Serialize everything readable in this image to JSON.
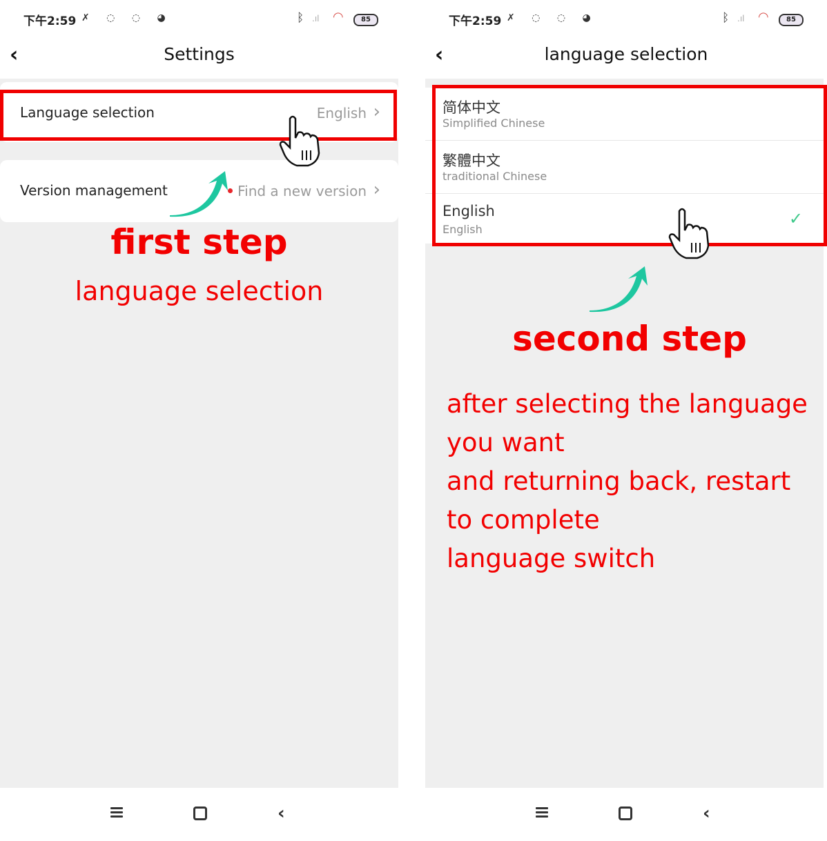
{
  "status_bar": {
    "time": "下午2:59",
    "battery": "85"
  },
  "screen1": {
    "title": "Settings",
    "rows": [
      {
        "label": "Language selection",
        "value": "English"
      },
      {
        "label": "Version management",
        "value": "Find a new version"
      }
    ],
    "annotation_step": "first step",
    "annotation_note": "language selection"
  },
  "screen2": {
    "title": "language selection",
    "languages": [
      {
        "name": "简体中文",
        "subtitle": "Simplified Chinese",
        "selected": false
      },
      {
        "name": "繁體中文",
        "subtitle": "traditional Chinese",
        "selected": false
      },
      {
        "name": "English",
        "subtitle": "English",
        "selected": true
      }
    ],
    "annotation_step": "second step",
    "annotation_lines": [
      "after selecting the language",
      "you want",
      "and returning back, restart",
      "to complete",
      "language switch"
    ]
  },
  "colors": {
    "annotation_red": "#f20000",
    "arrow_green": "#1ec7a0",
    "check_green": "#3fc98a"
  },
  "icons": [
    "back-icon",
    "chevron-right-icon",
    "hand-pointer-icon",
    "curved-arrow-icon",
    "checkmark-icon",
    "menu-nav-icon",
    "home-nav-icon",
    "back-nav-icon"
  ]
}
